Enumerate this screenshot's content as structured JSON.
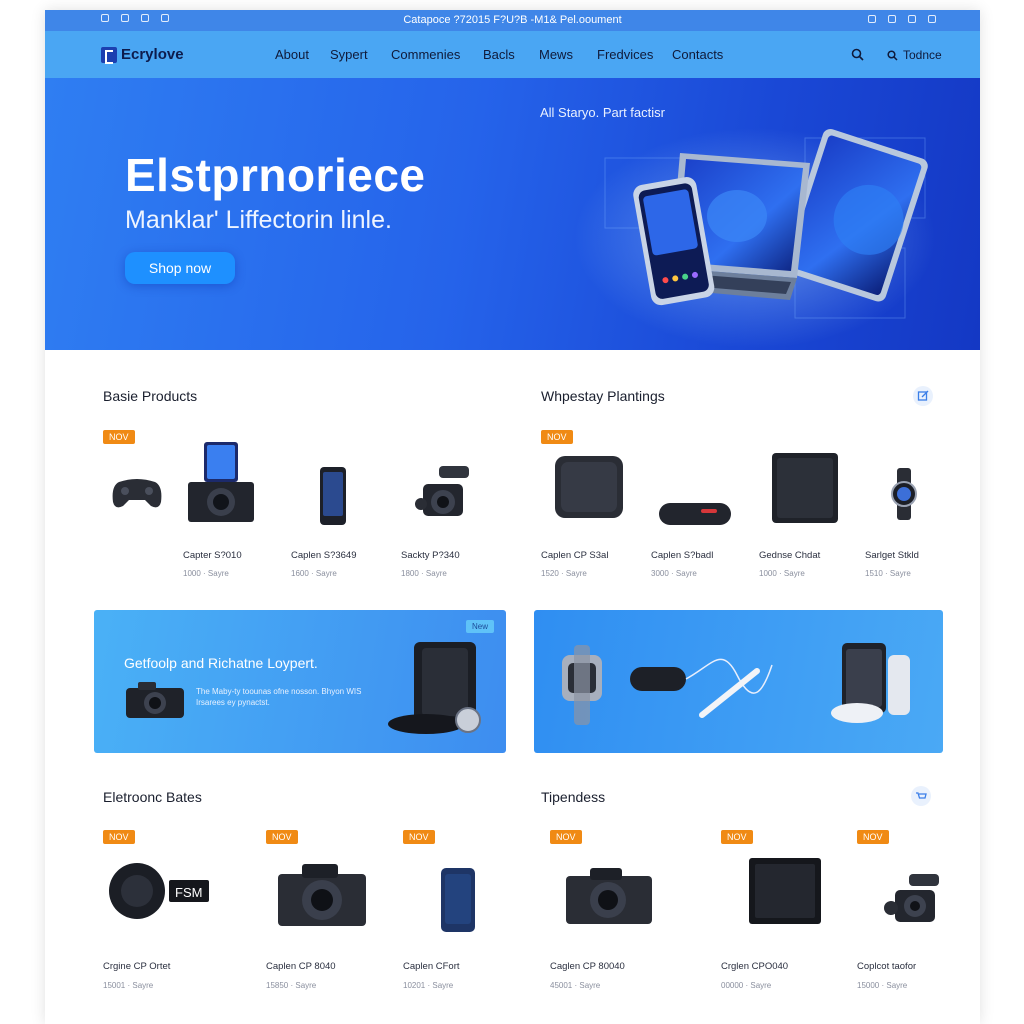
{
  "window": {
    "title": "Catapoce ?72015 F?U?B -M1& Pel.ooument"
  },
  "nav": {
    "logo": "Ecrylove",
    "links": [
      "About",
      "Sypert",
      "Commenies",
      "Bacls",
      "Mews",
      "Fredvices",
      "Contacts"
    ],
    "account_label": "Todnce"
  },
  "hero": {
    "title": "Elstprnoriece",
    "subtitle": "Manklar' Liffectorin linle.",
    "button": "Shop now",
    "tagline": "All Staryo. Part factisr"
  },
  "sections": {
    "basic": {
      "title": "Basie Products",
      "badge": "NOV",
      "items": [
        {
          "name": "",
          "meta": "",
          "icon": "gamepad-icon"
        },
        {
          "name": "Capter S?010",
          "meta": "1000 · Sayre",
          "icon": "camera-icon"
        },
        {
          "name": "Caplen S?3649",
          "meta": "1600 · Sayre",
          "icon": "phone-icon"
        },
        {
          "name": "Sackty P?340",
          "meta": "1800 · Sayre",
          "icon": "camcorder-icon"
        }
      ]
    },
    "whpestay": {
      "title": "Whpestay Plantings",
      "badge": "NOV",
      "items": [
        {
          "name": "Caplen CP S3al",
          "meta": "1520 · Sayre",
          "icon": "speaker-box-icon"
        },
        {
          "name": "Caplen S?badl",
          "meta": "3000 · Sayre",
          "icon": "soundbar-icon"
        },
        {
          "name": "Gednse Chdat",
          "meta": "1000 · Sayre",
          "icon": "router-box-icon"
        },
        {
          "name": "Sarlget Stkld",
          "meta": "1510 · Sayre",
          "icon": "watch-icon"
        }
      ]
    },
    "electronic": {
      "title": "Eletroonc Bates",
      "badge": "NOV",
      "items": [
        {
          "name": "Crgine CP Ortet",
          "meta": "15001 · Sayre",
          "icon": "speaker-icon",
          "label": "FSM"
        },
        {
          "name": "Caplen CP 8040",
          "meta": "15850 · Sayre",
          "icon": "camera-icon"
        },
        {
          "name": "Caplen CFort",
          "meta": "10201 · Sayre",
          "icon": "phone-icon"
        }
      ]
    },
    "tipendess": {
      "title": "Tipendess",
      "badge": "NOV",
      "items": [
        {
          "name": "Caglen CP 80040",
          "meta": "45001 · Sayre",
          "icon": "camera-icon"
        },
        {
          "name": "Crglen CPO040",
          "meta": "00000 · Sayre",
          "icon": "monitor-box-icon"
        },
        {
          "name": "Coplcot taofor",
          "meta": "15000 · Sayre",
          "icon": "camcorder-icon"
        }
      ]
    }
  },
  "promos": {
    "left": {
      "title": "Getfoolp and Richatne Loypert.",
      "text": "The Maby-ty toounas ofne nosson. Bhyon WIS Irsarees ey pynactst.",
      "tag": "New"
    }
  },
  "colors": {
    "accent": "#2563ea",
    "nav": "#4aa6f3",
    "badge": "#f08a14"
  }
}
